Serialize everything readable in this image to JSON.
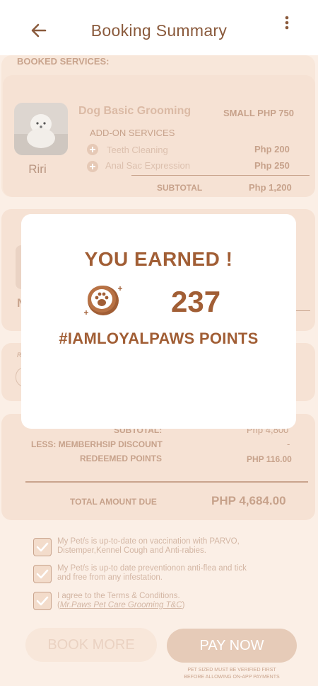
{
  "header": {
    "title": "Booking Summary"
  },
  "booked_services": {
    "heading": "BOOKED SERVICES:",
    "pet_name": "Riri",
    "service_name": "Dog Basic Grooming",
    "size_price": "SMALL PHP 750",
    "addon_heading": "ADD-ON SERVICES",
    "addons": [
      {
        "name": "Teeth Cleaning",
        "price": "Php 200"
      },
      {
        "name": "Anal Sac Expression",
        "price": "Php 250"
      }
    ],
    "subtotal_label": "SUBTOTAL",
    "subtotal_value": "Php 1,200"
  },
  "second_card": {
    "pet_initial": "N"
  },
  "third_card": {
    "label_initial": "R"
  },
  "summary": {
    "subtotal_label": "SUBTOTAL:",
    "subtotal_value": "Php 4,800",
    "discount_label": "LESS: MEMBERHSIP DISCOUNT",
    "discount_value": "-",
    "redeemed_label": "REDEEMED POINTS",
    "redeemed_value": "PHP 116.00",
    "total_label": "TOTAL AMOUNT DUE",
    "total_value": "PHP 4,684.00"
  },
  "agreements": [
    {
      "line1": "My Pet/s is up-to-date on vaccination with PARVO,",
      "line2": "Distemper,Kennel Cough and Anti-rabies.",
      "checked": true
    },
    {
      "line1": "My Pet/s is up-to date preventionon anti-flea and tick",
      "line2": "and free from any infestation.",
      "checked": true
    },
    {
      "line1": "I agree to the Terms & Conditions.",
      "line2_prefix": "(",
      "link": "Mr.Paws Pet Care Grooming T&C",
      "line2_suffix": ")",
      "checked": true
    }
  ],
  "buttons": {
    "book_more": "BOOK MORE",
    "pay_now": "PAY NOW"
  },
  "footnote": {
    "line1": "PET SIZED MUST BE VERIFIED FIRST",
    "line2": "BEFORE ALLOWING ON-APP PAYMENTS"
  },
  "modal": {
    "earned_text": "YOU EARNED !",
    "points": "237",
    "program": "#IAMLOYALPAWS POINTS"
  },
  "colors": {
    "accent": "#a15e35",
    "muted": "#c9a48d",
    "card": "#f8e7da"
  }
}
